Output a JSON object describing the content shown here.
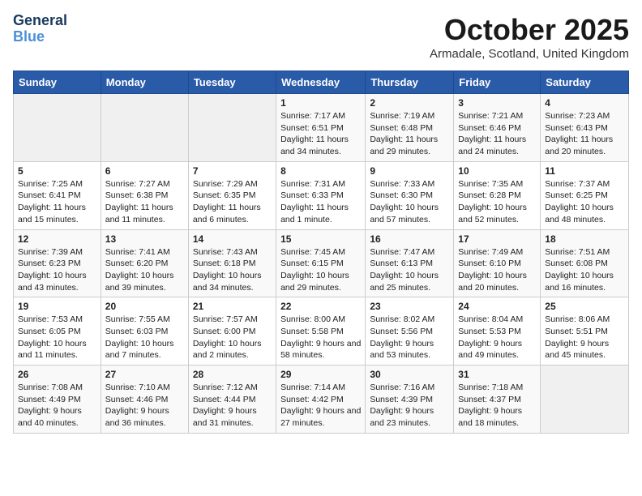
{
  "header": {
    "logo_line1": "General",
    "logo_line2": "Blue",
    "month": "October 2025",
    "location": "Armadale, Scotland, United Kingdom"
  },
  "days_of_week": [
    "Sunday",
    "Monday",
    "Tuesday",
    "Wednesday",
    "Thursday",
    "Friday",
    "Saturday"
  ],
  "weeks": [
    [
      {
        "day": "",
        "content": ""
      },
      {
        "day": "",
        "content": ""
      },
      {
        "day": "",
        "content": ""
      },
      {
        "day": "1",
        "content": "Sunrise: 7:17 AM\nSunset: 6:51 PM\nDaylight: 11 hours and 34 minutes."
      },
      {
        "day": "2",
        "content": "Sunrise: 7:19 AM\nSunset: 6:48 PM\nDaylight: 11 hours and 29 minutes."
      },
      {
        "day": "3",
        "content": "Sunrise: 7:21 AM\nSunset: 6:46 PM\nDaylight: 11 hours and 24 minutes."
      },
      {
        "day": "4",
        "content": "Sunrise: 7:23 AM\nSunset: 6:43 PM\nDaylight: 11 hours and 20 minutes."
      }
    ],
    [
      {
        "day": "5",
        "content": "Sunrise: 7:25 AM\nSunset: 6:41 PM\nDaylight: 11 hours and 15 minutes."
      },
      {
        "day": "6",
        "content": "Sunrise: 7:27 AM\nSunset: 6:38 PM\nDaylight: 11 hours and 11 minutes."
      },
      {
        "day": "7",
        "content": "Sunrise: 7:29 AM\nSunset: 6:35 PM\nDaylight: 11 hours and 6 minutes."
      },
      {
        "day": "8",
        "content": "Sunrise: 7:31 AM\nSunset: 6:33 PM\nDaylight: 11 hours and 1 minute."
      },
      {
        "day": "9",
        "content": "Sunrise: 7:33 AM\nSunset: 6:30 PM\nDaylight: 10 hours and 57 minutes."
      },
      {
        "day": "10",
        "content": "Sunrise: 7:35 AM\nSunset: 6:28 PM\nDaylight: 10 hours and 52 minutes."
      },
      {
        "day": "11",
        "content": "Sunrise: 7:37 AM\nSunset: 6:25 PM\nDaylight: 10 hours and 48 minutes."
      }
    ],
    [
      {
        "day": "12",
        "content": "Sunrise: 7:39 AM\nSunset: 6:23 PM\nDaylight: 10 hours and 43 minutes."
      },
      {
        "day": "13",
        "content": "Sunrise: 7:41 AM\nSunset: 6:20 PM\nDaylight: 10 hours and 39 minutes."
      },
      {
        "day": "14",
        "content": "Sunrise: 7:43 AM\nSunset: 6:18 PM\nDaylight: 10 hours and 34 minutes."
      },
      {
        "day": "15",
        "content": "Sunrise: 7:45 AM\nSunset: 6:15 PM\nDaylight: 10 hours and 29 minutes."
      },
      {
        "day": "16",
        "content": "Sunrise: 7:47 AM\nSunset: 6:13 PM\nDaylight: 10 hours and 25 minutes."
      },
      {
        "day": "17",
        "content": "Sunrise: 7:49 AM\nSunset: 6:10 PM\nDaylight: 10 hours and 20 minutes."
      },
      {
        "day": "18",
        "content": "Sunrise: 7:51 AM\nSunset: 6:08 PM\nDaylight: 10 hours and 16 minutes."
      }
    ],
    [
      {
        "day": "19",
        "content": "Sunrise: 7:53 AM\nSunset: 6:05 PM\nDaylight: 10 hours and 11 minutes."
      },
      {
        "day": "20",
        "content": "Sunrise: 7:55 AM\nSunset: 6:03 PM\nDaylight: 10 hours and 7 minutes."
      },
      {
        "day": "21",
        "content": "Sunrise: 7:57 AM\nSunset: 6:00 PM\nDaylight: 10 hours and 2 minutes."
      },
      {
        "day": "22",
        "content": "Sunrise: 8:00 AM\nSunset: 5:58 PM\nDaylight: 9 hours and 58 minutes."
      },
      {
        "day": "23",
        "content": "Sunrise: 8:02 AM\nSunset: 5:56 PM\nDaylight: 9 hours and 53 minutes."
      },
      {
        "day": "24",
        "content": "Sunrise: 8:04 AM\nSunset: 5:53 PM\nDaylight: 9 hours and 49 minutes."
      },
      {
        "day": "25",
        "content": "Sunrise: 8:06 AM\nSunset: 5:51 PM\nDaylight: 9 hours and 45 minutes."
      }
    ],
    [
      {
        "day": "26",
        "content": "Sunrise: 7:08 AM\nSunset: 4:49 PM\nDaylight: 9 hours and 40 minutes."
      },
      {
        "day": "27",
        "content": "Sunrise: 7:10 AM\nSunset: 4:46 PM\nDaylight: 9 hours and 36 minutes."
      },
      {
        "day": "28",
        "content": "Sunrise: 7:12 AM\nSunset: 4:44 PM\nDaylight: 9 hours and 31 minutes."
      },
      {
        "day": "29",
        "content": "Sunrise: 7:14 AM\nSunset: 4:42 PM\nDaylight: 9 hours and 27 minutes."
      },
      {
        "day": "30",
        "content": "Sunrise: 7:16 AM\nSunset: 4:39 PM\nDaylight: 9 hours and 23 minutes."
      },
      {
        "day": "31",
        "content": "Sunrise: 7:18 AM\nSunset: 4:37 PM\nDaylight: 9 hours and 18 minutes."
      },
      {
        "day": "",
        "content": ""
      }
    ]
  ]
}
